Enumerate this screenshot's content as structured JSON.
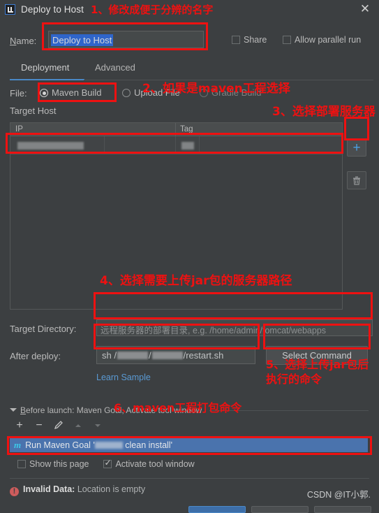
{
  "window": {
    "title": "Deploy to Host",
    "app_icon": "intellij-idea-icon",
    "close_label": "✕"
  },
  "name_row": {
    "label": "Name:",
    "label_mnemonic": "N",
    "value": "Deploy to Host",
    "share_label": "Share",
    "share_checked": false,
    "allow_parallel_label": "Allow parallel run",
    "allow_parallel_checked": false
  },
  "tabs": [
    {
      "label": "Deployment",
      "active": true
    },
    {
      "label": "Advanced",
      "active": false
    }
  ],
  "file_row": {
    "label": "File:",
    "options": [
      {
        "label": "Maven Build",
        "selected": true,
        "enabled": true
      },
      {
        "label": "Upload File",
        "selected": false,
        "enabled": true
      },
      {
        "label": "Gradle Build",
        "selected": false,
        "enabled": false
      }
    ]
  },
  "target_host": {
    "section_label": "Target Host",
    "columns": [
      "IP",
      "Tag"
    ],
    "rows": [
      {
        "ip": "[redacted]",
        "tag": "[redacted]"
      }
    ],
    "add_button": "+",
    "delete_button": "trash-icon"
  },
  "target_directory": {
    "label": "Target Directory:",
    "value": "",
    "placeholder": "远程服务器的部署目录, e.g. /home/admin/tomcat/webapps"
  },
  "after_deploy": {
    "label": "After deploy:",
    "value_prefix": "sh /",
    "value_mid": "/",
    "value_suffix": "/restart.sh",
    "select_command_label": "Select Command",
    "learn_sample_label": "Learn Sample"
  },
  "before_launch": {
    "header": "Before launch: Maven Goal, Activate tool window",
    "header_mnemonic": "B",
    "toolbar": [
      "+",
      "−",
      "pencil-icon",
      "move-up-icon",
      "move-down-icon"
    ],
    "item_icon": "maven-icon",
    "item_prefix": "Run Maven Goal '",
    "item_suffix": " clean install'",
    "show_this_page_label": "Show this page",
    "show_this_page_checked": false,
    "activate_tool_window_label": "Activate tool window",
    "activate_tool_window_checked": true
  },
  "status": {
    "error_icon": "error-icon",
    "error_title": "Invalid Data:",
    "error_message": "Location is empty"
  },
  "watermark": "CSDN @IT小郭.",
  "annotations": [
    {
      "id": 1,
      "text": "1、修改成便于分辨的名字"
    },
    {
      "id": 2,
      "text": "2、如果是maven工程选择"
    },
    {
      "id": 3,
      "text": "3、选择部署服务器"
    },
    {
      "id": 4,
      "text": "4、选择需要上传jar包的服务器路径"
    },
    {
      "id": 5,
      "text": "5、选择上传jar包后"
    },
    {
      "id": 6,
      "text": "执行的命令"
    },
    {
      "id": 7,
      "text": "6、maven工程打包命令"
    }
  ],
  "colors": {
    "background": "#3c3f41",
    "annotation_red": "#ee1111",
    "accent_blue": "#4a88c7",
    "selection_blue": "#2f65ca",
    "link_blue": "#5a9ad4",
    "error_red": "#cd5c5c",
    "maven_row_blue": "#4a73ad"
  }
}
